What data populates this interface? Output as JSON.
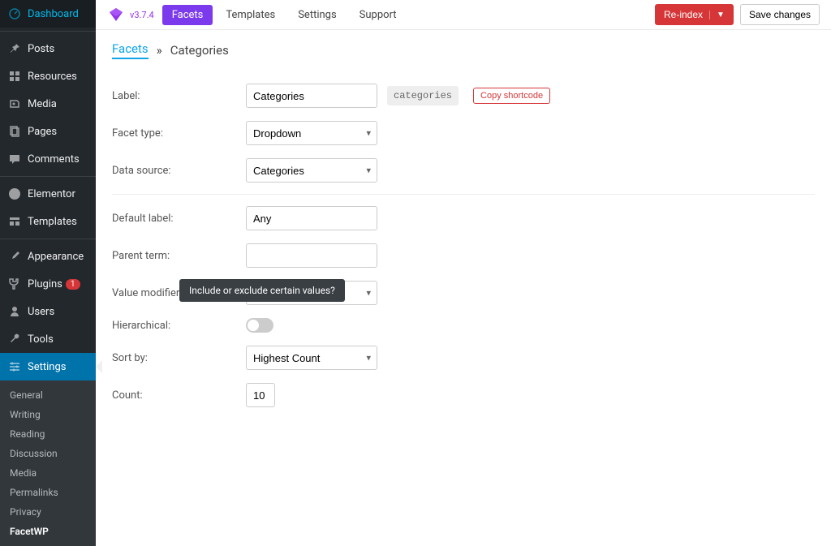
{
  "sidebar": {
    "items": [
      {
        "icon": "dashboard",
        "label": "Dashboard"
      },
      {
        "icon": "pin",
        "label": "Posts"
      },
      {
        "icon": "grid",
        "label": "Resources"
      },
      {
        "icon": "media",
        "label": "Media"
      },
      {
        "icon": "page",
        "label": "Pages"
      },
      {
        "icon": "comment",
        "label": "Comments"
      },
      {
        "icon": "elementor",
        "label": "Elementor"
      },
      {
        "icon": "templates",
        "label": "Templates"
      },
      {
        "icon": "brush",
        "label": "Appearance"
      },
      {
        "icon": "plug",
        "label": "Plugins",
        "badge": "1"
      },
      {
        "icon": "users",
        "label": "Users"
      },
      {
        "icon": "wrench",
        "label": "Tools"
      },
      {
        "icon": "sliders",
        "label": "Settings",
        "active": true
      }
    ],
    "submenu": [
      {
        "label": "General"
      },
      {
        "label": "Writing"
      },
      {
        "label": "Reading"
      },
      {
        "label": "Discussion"
      },
      {
        "label": "Media"
      },
      {
        "label": "Permalinks"
      },
      {
        "label": "Privacy"
      },
      {
        "label": "FacetWP",
        "active": true
      }
    ]
  },
  "topbar": {
    "version": "v3.7.4",
    "nav": [
      {
        "label": "Facets",
        "active": true
      },
      {
        "label": "Templates"
      },
      {
        "label": "Settings"
      },
      {
        "label": "Support"
      }
    ],
    "reindex": "Re-index",
    "save": "Save changes"
  },
  "breadcrumb": {
    "link": "Facets",
    "sep": "»",
    "current": "Categories"
  },
  "form": {
    "label": {
      "label": "Label:",
      "value": "Categories"
    },
    "slug": "categories",
    "copy": "Copy shortcode",
    "facet_type": {
      "label": "Facet type:",
      "value": "Dropdown"
    },
    "data_source": {
      "label": "Data source:",
      "value": "Categories"
    },
    "default_label": {
      "label": "Default label:",
      "value": "Any"
    },
    "parent_term": {
      "label": "Parent term:",
      "value": ""
    },
    "value_modifiers": {
      "label": "Value modifiers:",
      "value": "",
      "tooltip": "Include or exclude certain values?"
    },
    "hierarchical": {
      "label": "Hierarchical:"
    },
    "sort_by": {
      "label": "Sort by:",
      "value": "Highest Count"
    },
    "count": {
      "label": "Count:",
      "value": "10"
    }
  }
}
